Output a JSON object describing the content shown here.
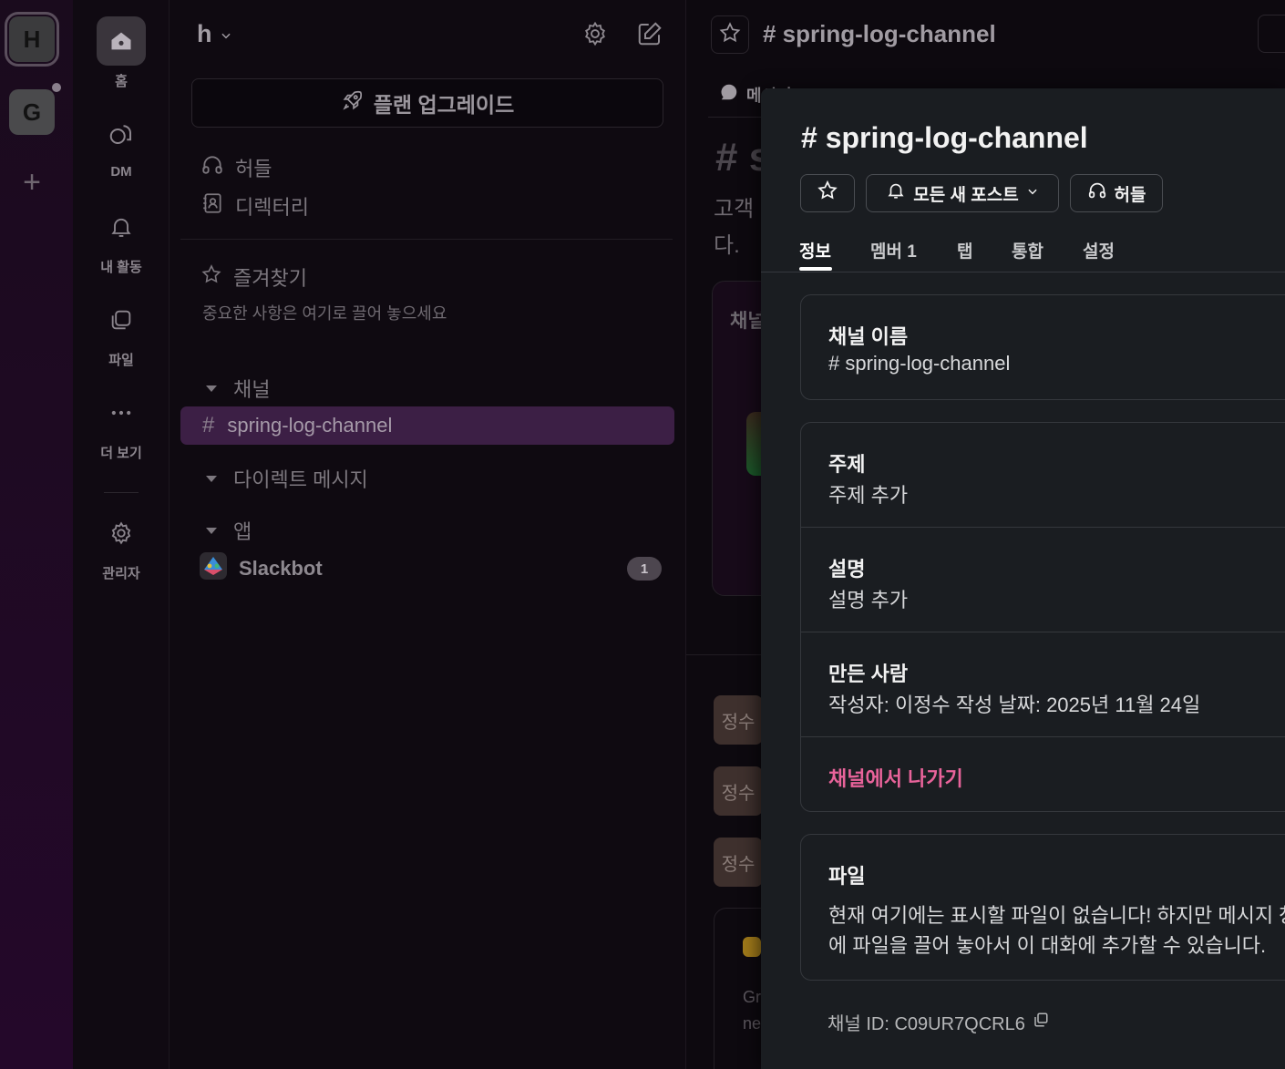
{
  "workspaces": {
    "items": [
      {
        "letter": "H",
        "active": true
      },
      {
        "letter": "G",
        "active": false
      }
    ],
    "add_label": "+"
  },
  "nav": {
    "items": [
      {
        "label": "홈",
        "icon": "home-icon"
      },
      {
        "label": "DM",
        "icon": "dm-icon"
      },
      {
        "label": "내 활동",
        "icon": "bell-icon"
      },
      {
        "label": "파일",
        "icon": "files-icon"
      },
      {
        "label": "더 보기",
        "icon": "more-icon"
      },
      {
        "label": "관리자",
        "icon": "gear-icon"
      }
    ]
  },
  "sidebar": {
    "workspace_name": "h",
    "upgrade_label": "플랜 업그레이드",
    "huddles_label": "허들",
    "directory_label": "디렉터리",
    "favorites_label": "즐겨찾기",
    "favorites_hint": "중요한 사항은 여기로 끌어 놓으세요",
    "channels_section": "채널",
    "active_channel": "spring-log-channel",
    "dm_section": "다이렉트 메시지",
    "apps_section": "앱",
    "slackbot_label": "Slackbot",
    "slackbot_badge": "1"
  },
  "main": {
    "title": "# spring-log-channel",
    "tab_fragment": "메시지",
    "hash_big": "# s",
    "desc_line1": "고객",
    "desc_line2": "다.",
    "card_text": "채널",
    "avatar_1": "정수",
    "avatar_2": "정수",
    "avatar_3": "정수",
    "msg_frag_1": "Gr",
    "msg_frag_2": "ne"
  },
  "panel": {
    "title": "# spring-log-channel",
    "notify_label": "모든 새 포스트",
    "huddle_label": "허들",
    "tabs": [
      {
        "label": "정보",
        "active": true
      },
      {
        "label": "멤버 1",
        "active": false
      },
      {
        "label": "탭",
        "active": false
      },
      {
        "label": "통합",
        "active": false
      },
      {
        "label": "설정",
        "active": false
      }
    ],
    "channel_name_label": "채널 이름",
    "channel_name_value": "# spring-log-channel",
    "topic_label": "주제",
    "topic_value": "주제 추가",
    "description_label": "설명",
    "description_value": "설명 추가",
    "creator_label": "만든 사람",
    "creator_value": "작성자: 이정수 작성 날짜: 2025년 11월 24일",
    "leave_label": "채널에서 나가기",
    "files_label": "파일",
    "files_text": "현재 여기에는 표시할 파일이 없습니다! 하지만 메시지 창에 파일을 끌어 놓아서 이 대화에 추가할 수 있습니다.",
    "channel_id": "채널 ID: C09UR7QCRL6"
  },
  "colors": {
    "accent_active_channel": "#3c1f45",
    "leave_text": "#e8639a",
    "panel_bg": "#1a1d21"
  }
}
